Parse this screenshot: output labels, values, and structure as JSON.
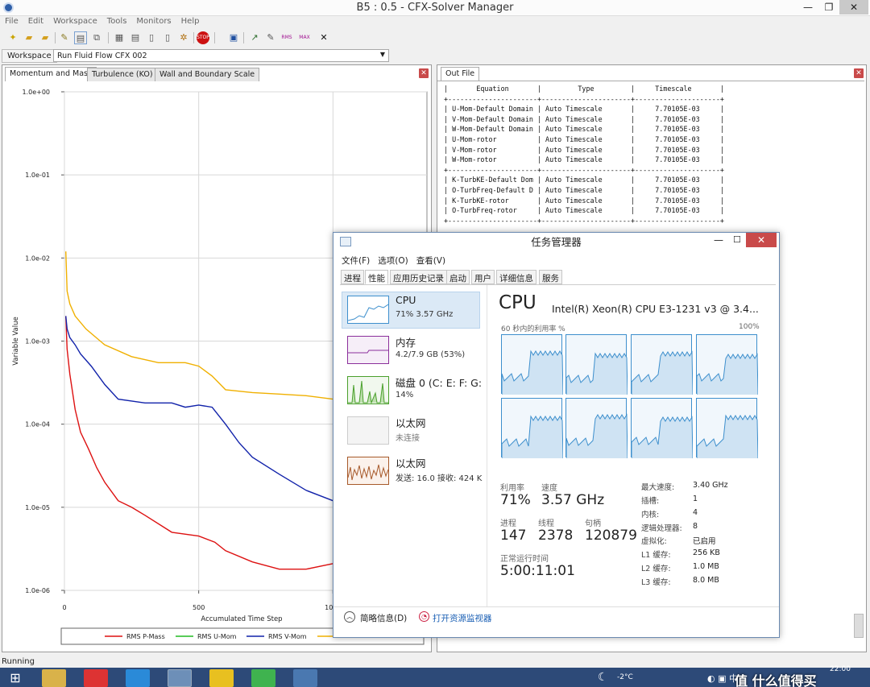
{
  "window": {
    "title": "B5 : 0.5 - CFX-Solver Manager"
  },
  "menu": [
    "File",
    "Edit",
    "Workspace",
    "Tools",
    "Monitors",
    "Help"
  ],
  "workspace": {
    "label": "Workspace",
    "selected": "Run Fluid Flow CFX 002"
  },
  "left_tabs": [
    "Momentum and Mass",
    "Turbulence (KO)",
    "Wall and Boundary Scale"
  ],
  "out_file_tab": "Out File",
  "status": "Running",
  "out_text": "|       Equation       |         Type         |     Timescale       |\n+----------------------+----------------------+---------------------+\n| U-Mom-Default Domain | Auto Timescale       |     7.70105E-03     |\n| V-Mom-Default Domain | Auto Timescale       |     7.70105E-03     |\n| W-Mom-Default Domain | Auto Timescale       |     7.70105E-03     |\n| U-Mom-rotor          | Auto Timescale       |     7.70105E-03     |\n| V-Mom-rotor          | Auto Timescale       |     7.70105E-03     |\n| W-Mom-rotor          | Auto Timescale       |     7.70105E-03     |\n+----------------------+----------------------+---------------------+\n| K-TurbKE-Default Dom | Auto Timescale       |     7.70105E-03     |\n| O-TurbFreq-Default D | Auto Timescale       |     7.70105E-03     |\n| K-TurbKE-rotor       | Auto Timescale       |     7.70105E-03     |\n| O-TurbFreq-rotor     | Auto Timescale       |     7.70105E-03     |\n+----------------------+----------------------+---------------------+",
  "chart_data": {
    "type": "line",
    "xlabel": "Accumulated Time Step",
    "ylabel": "Variable Value",
    "y_log": true,
    "ylim": [
      1e-06,
      1
    ],
    "xlim": [
      0,
      1350
    ],
    "y_ticks": [
      "1.0e+00",
      "1.0e-01",
      "1.0e-02",
      "1.0e-03",
      "1.0e-04",
      "1.0e-05",
      "1.0e-06"
    ],
    "x_ticks": [
      "0",
      "500",
      "1000"
    ],
    "grid": true,
    "legend_placement": "bottom",
    "series": [
      {
        "name": "RMS P-Mass",
        "color": "#dd1111",
        "x": [
          5,
          10,
          20,
          40,
          60,
          90,
          120,
          150,
          200,
          250,
          300,
          400,
          500,
          560,
          600,
          700,
          800,
          900,
          1000,
          1050,
          1100,
          1150,
          1200,
          1280,
          1350
        ],
        "y": [
          0.002,
          0.0008,
          0.0004,
          0.00015,
          8e-05,
          5e-05,
          3e-05,
          2e-05,
          1.2e-05,
          1e-05,
          8e-06,
          5e-06,
          4.5e-06,
          3.8e-06,
          3e-06,
          2.2e-06,
          1.8e-06,
          1.8e-06,
          2.1e-06,
          2.3e-06,
          2.4e-06,
          2.3e-06,
          2e-06,
          1.7e-06,
          1.5e-06
        ]
      },
      {
        "name": "RMS U-Mom",
        "color": "#22bb22",
        "x": [],
        "y": []
      },
      {
        "name": "RMS V-Mom",
        "color": "#1122aa",
        "x": [
          5,
          10,
          20,
          40,
          60,
          100,
          150,
          200,
          300,
          400,
          450,
          500,
          550,
          600,
          650,
          700,
          800,
          900,
          1000,
          1100,
          1200,
          1280,
          1350
        ],
        "y": [
          0.002,
          0.0014,
          0.0011,
          0.0009,
          0.0007,
          0.0005,
          0.0003,
          0.0002,
          0.00018,
          0.00018,
          0.00016,
          0.00017,
          0.00016,
          0.0001,
          6e-05,
          4e-05,
          2.5e-05,
          1.6e-05,
          1.2e-05,
          1e-05,
          8.5e-06,
          7.5e-06,
          7.1e-06
        ]
      },
      {
        "name": "",
        "color": "#f0b000",
        "x": [
          5,
          10,
          20,
          40,
          80,
          150,
          250,
          350,
          450,
          500,
          550,
          600,
          700,
          800,
          900,
          1000,
          1100,
          1200,
          1280,
          1350
        ],
        "y": [
          0.012,
          0.004,
          0.0028,
          0.002,
          0.0014,
          0.0009,
          0.00065,
          0.00055,
          0.00055,
          0.0005,
          0.00038,
          0.00026,
          0.00024,
          0.00023,
          0.00022,
          0.0002,
          0.00018,
          0.00017,
          0.00016,
          0.00015
        ]
      }
    ]
  },
  "taskmgr": {
    "title": "任务管理器",
    "menu": [
      "文件(F)",
      "选项(O)",
      "查看(V)"
    ],
    "tabs": [
      "进程",
      "性能",
      "应用历史记录",
      "启动",
      "用户",
      "详细信息",
      "服务"
    ],
    "resources": [
      {
        "name": "CPU",
        "sub": "71%  3.57 GHz"
      },
      {
        "name": "内存",
        "sub": "4.2/7.9 GB (53%)"
      },
      {
        "name": "磁盘 0 (C: E: F: G:",
        "sub": "14%"
      },
      {
        "name": "以太网",
        "sub": "未连接"
      },
      {
        "name": "以太网",
        "sub": "发送: 16.0  接收: 424 K"
      }
    ],
    "cpu_header": "CPU",
    "cpu_model": "Intel(R) Xeon(R) CPU E3-1231 v3 @ 3.4...",
    "graph_caption": "60 秒内的利用率 %",
    "graph_max": "100%",
    "stats": {
      "util_label": "利用率",
      "util": "71%",
      "speed_label": "速度",
      "speed": "3.57 GHz",
      "proc_label": "进程",
      "proc": "147",
      "thread_label": "线程",
      "thread": "2378",
      "handle_label": "句柄",
      "handle": "120879",
      "uptime_label": "正常运行时间",
      "uptime": "5:00:11:01"
    },
    "specs": [
      {
        "k": "最大速度:",
        "v": "3.40 GHz"
      },
      {
        "k": "插槽:",
        "v": "1"
      },
      {
        "k": "内核:",
        "v": "4"
      },
      {
        "k": "逻辑处理器:",
        "v": "8"
      },
      {
        "k": "虚拟化:",
        "v": "已启用"
      },
      {
        "k": "L1 缓存:",
        "v": "256 KB"
      },
      {
        "k": "L2 缓存:",
        "v": "1.0 MB"
      },
      {
        "k": "L3 缓存:",
        "v": "8.0 MB"
      }
    ],
    "footer_less": "简略信息(D)",
    "footer_monitor": "打开资源监视器"
  },
  "taskbar": {
    "temp": "-2°C",
    "watermark": "值 什么值得买",
    "time": "22:00"
  },
  "colors": {
    "accent": "#3d8fcd",
    "close": "#c94a4a",
    "taskbar": "#2d4a78"
  }
}
